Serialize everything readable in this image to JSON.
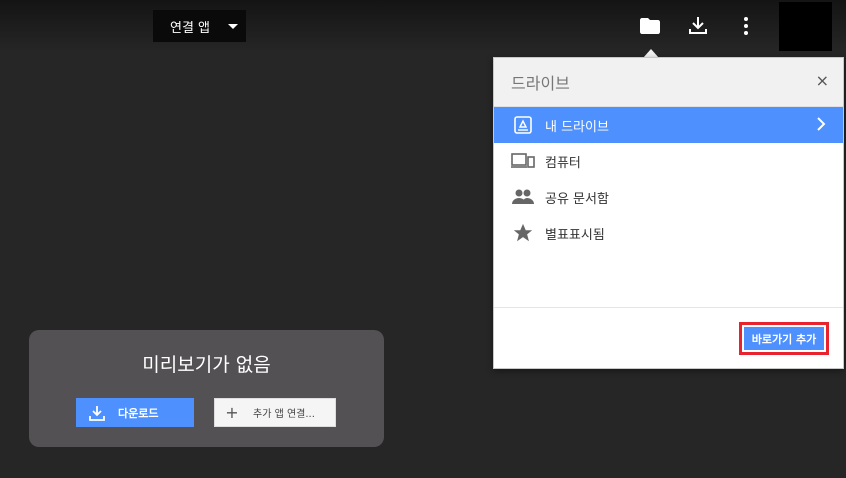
{
  "topbar": {
    "open_with_label": "연결 앱"
  },
  "drive_panel": {
    "title": "드라이브",
    "close_label": "×",
    "items": [
      {
        "label": "내 드라이브",
        "icon": "my-drive-icon",
        "selected": true
      },
      {
        "label": "컴퓨터",
        "icon": "computer-icon",
        "selected": false
      },
      {
        "label": "공유 문서함",
        "icon": "shared-people-icon",
        "selected": false
      },
      {
        "label": "별표표시됨",
        "icon": "star-icon",
        "selected": false
      }
    ],
    "add_shortcut_label": "바로가기 추가"
  },
  "preview": {
    "message": "미리보기가 없음",
    "download_label": "다운로드",
    "connect_label": "추가 앱 연결..."
  },
  "colors": {
    "accent": "#4d90fe",
    "highlight_border": "#e8232e",
    "background": "#262626"
  }
}
